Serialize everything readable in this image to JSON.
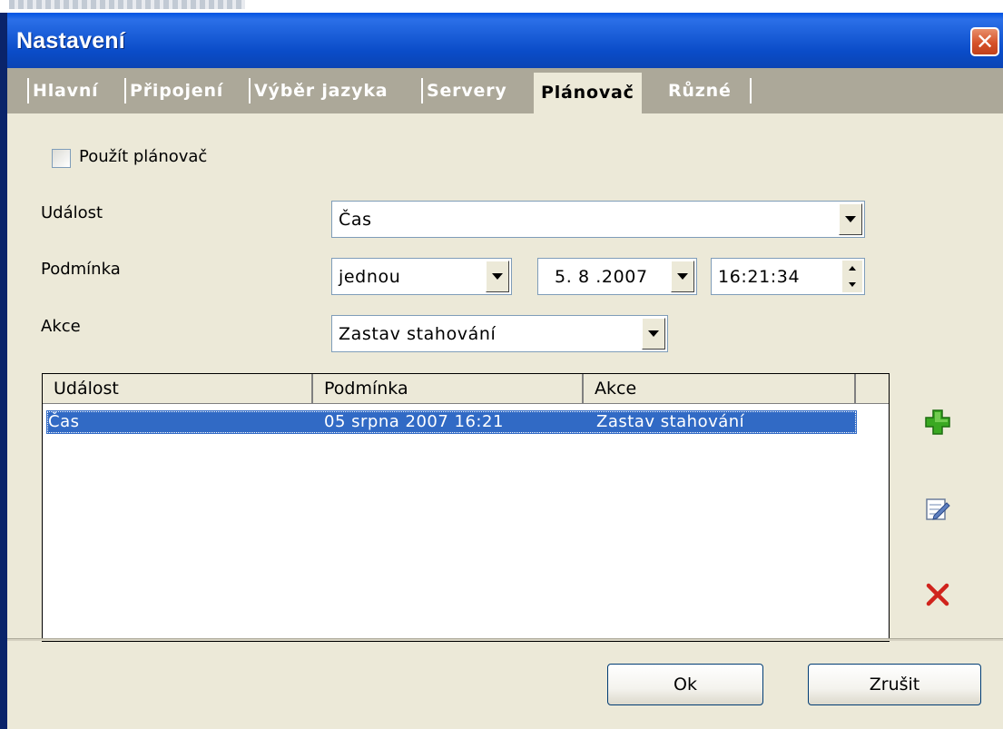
{
  "window": {
    "title": "Nastavení",
    "close_glyph": "✕"
  },
  "tabs": [
    {
      "label": "Hlavní",
      "active": false
    },
    {
      "label": "Připojení",
      "active": false
    },
    {
      "label": "Výběr jazyka",
      "active": false
    },
    {
      "label": "Servery",
      "active": false
    },
    {
      "label": "Plánovač",
      "active": true
    },
    {
      "label": "Různé",
      "active": false
    }
  ],
  "scheduler": {
    "use_label": "Použít plánovač",
    "use_checked": false,
    "event_label": "Událost",
    "event_value": "Čas",
    "condition_label": "Podmínka",
    "condition_value": "jednou",
    "date_value": "5. 8 .2007",
    "time_value": "16:21:34",
    "action_label": "Akce",
    "action_value": "Zastav stahování"
  },
  "table": {
    "columns": [
      "Událost",
      "Podmínka",
      "Akce"
    ],
    "rows": [
      {
        "event": "Čas",
        "condition": "05 srpna 2007 16:21",
        "action": "Zastav stahování",
        "selected": true
      }
    ]
  },
  "side_icons": [
    "add-icon",
    "edit-icon",
    "delete-icon"
  ],
  "buttons": {
    "ok": "Ok",
    "cancel": "Zrušit"
  },
  "colors": {
    "titlebar": "#0054e3",
    "selection": "#316ac5",
    "window_bg": "#ece9d8",
    "close": "#d6522a",
    "add": "#3aa822",
    "delete": "#d0231c"
  }
}
